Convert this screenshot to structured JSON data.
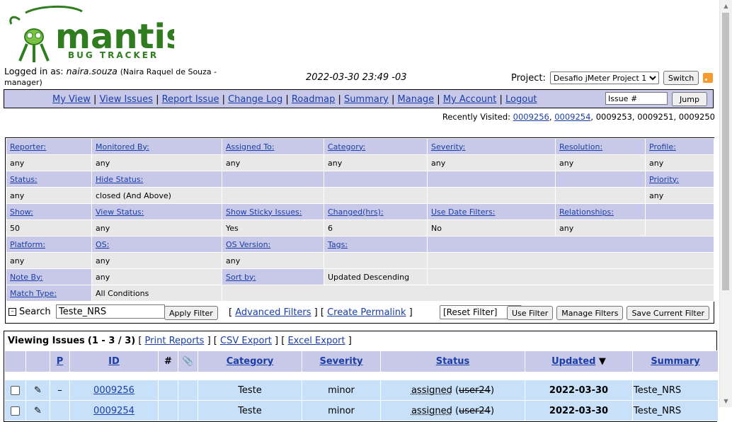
{
  "logo": {
    "name": "mantis",
    "tagline": "BUG TRACKER"
  },
  "login": {
    "prefix": "Logged in as:",
    "username": "naira.souza",
    "detail": "(Naira Raquel de Souza - manager)"
  },
  "clock": "2022-03-30 23:49 -03",
  "project": {
    "label": "Project:",
    "selected": "Desafio jMeter Project 1",
    "switch_label": "Switch",
    "rss_icon": "rss-icon"
  },
  "menu": {
    "items": [
      "My View",
      "View Issues",
      "Report Issue",
      "Change Log",
      "Roadmap",
      "Summary",
      "Manage",
      "My Account",
      "Logout"
    ],
    "jump_value": "Issue #",
    "jump_label": "Jump"
  },
  "recent": {
    "label": "Recently Visited:",
    "linked": [
      "0009256",
      "0009254"
    ],
    "plain": "0009253, 0009251, 0009250"
  },
  "filters": {
    "row1_h": [
      "Reporter:",
      "Monitored By:",
      "Assigned To:",
      "Category:",
      "Severity:",
      "Resolution:",
      "Profile:"
    ],
    "row1_v": [
      "any",
      "any",
      "any",
      "any",
      "any",
      "any",
      "any"
    ],
    "row2_h": [
      "Status:",
      "Hide Status:",
      "",
      "",
      "",
      "",
      "Priority:"
    ],
    "row2_v": [
      "any",
      "closed (And Above)",
      "",
      "",
      "",
      "",
      "any"
    ],
    "row3_h": [
      "Show:",
      "View Status:",
      "Show Sticky Issues:",
      "Changed(hrs):",
      "Use Date Filters:",
      "Relationships:"
    ],
    "row3_v": [
      "50",
      "any",
      "Yes",
      "6",
      "No",
      "any"
    ],
    "row4_h": [
      "Platform:",
      "OS:",
      "OS Version:",
      "Tags:"
    ],
    "row4_v": [
      "any",
      "any",
      "any",
      ""
    ],
    "row5_h": [
      "Note By:",
      "any",
      "Sort by:",
      "Updated Descending"
    ],
    "row6_h": [
      "Match Type:",
      "All Conditions"
    ],
    "search_label": "Search",
    "search_value": "Teste_NRS",
    "apply_label": "Apply Filter",
    "advanced_label": "Advanced Filters",
    "permalink_label": "Create Permalink",
    "reset_value": "[Reset Filter]",
    "use_filter_label": "Use Filter",
    "manage_filters_label": "Manage Filters",
    "save_filter_label": "Save Current Filter"
  },
  "issues": {
    "title": "Viewing Issues",
    "range": "(1 - 3 / 3)",
    "print_label": "Print Reports",
    "csv_label": "CSV Export",
    "excel_label": "Excel Export",
    "columns": [
      "P",
      "ID",
      "#",
      "Category",
      "Severity",
      "Status",
      "Updated",
      "Summary"
    ],
    "rows": [
      {
        "id": "0009256",
        "category": "Teste",
        "severity": "minor",
        "status": "assigned",
        "handler": "user24",
        "updated": "2022-03-30",
        "summary": "Teste_NRS",
        "priority": "–"
      },
      {
        "id": "0009254",
        "category": "Teste",
        "severity": "minor",
        "status": "assigned",
        "handler": "user24",
        "updated": "2022-03-30",
        "summary": "Teste_NRS",
        "priority": ""
      }
    ]
  }
}
